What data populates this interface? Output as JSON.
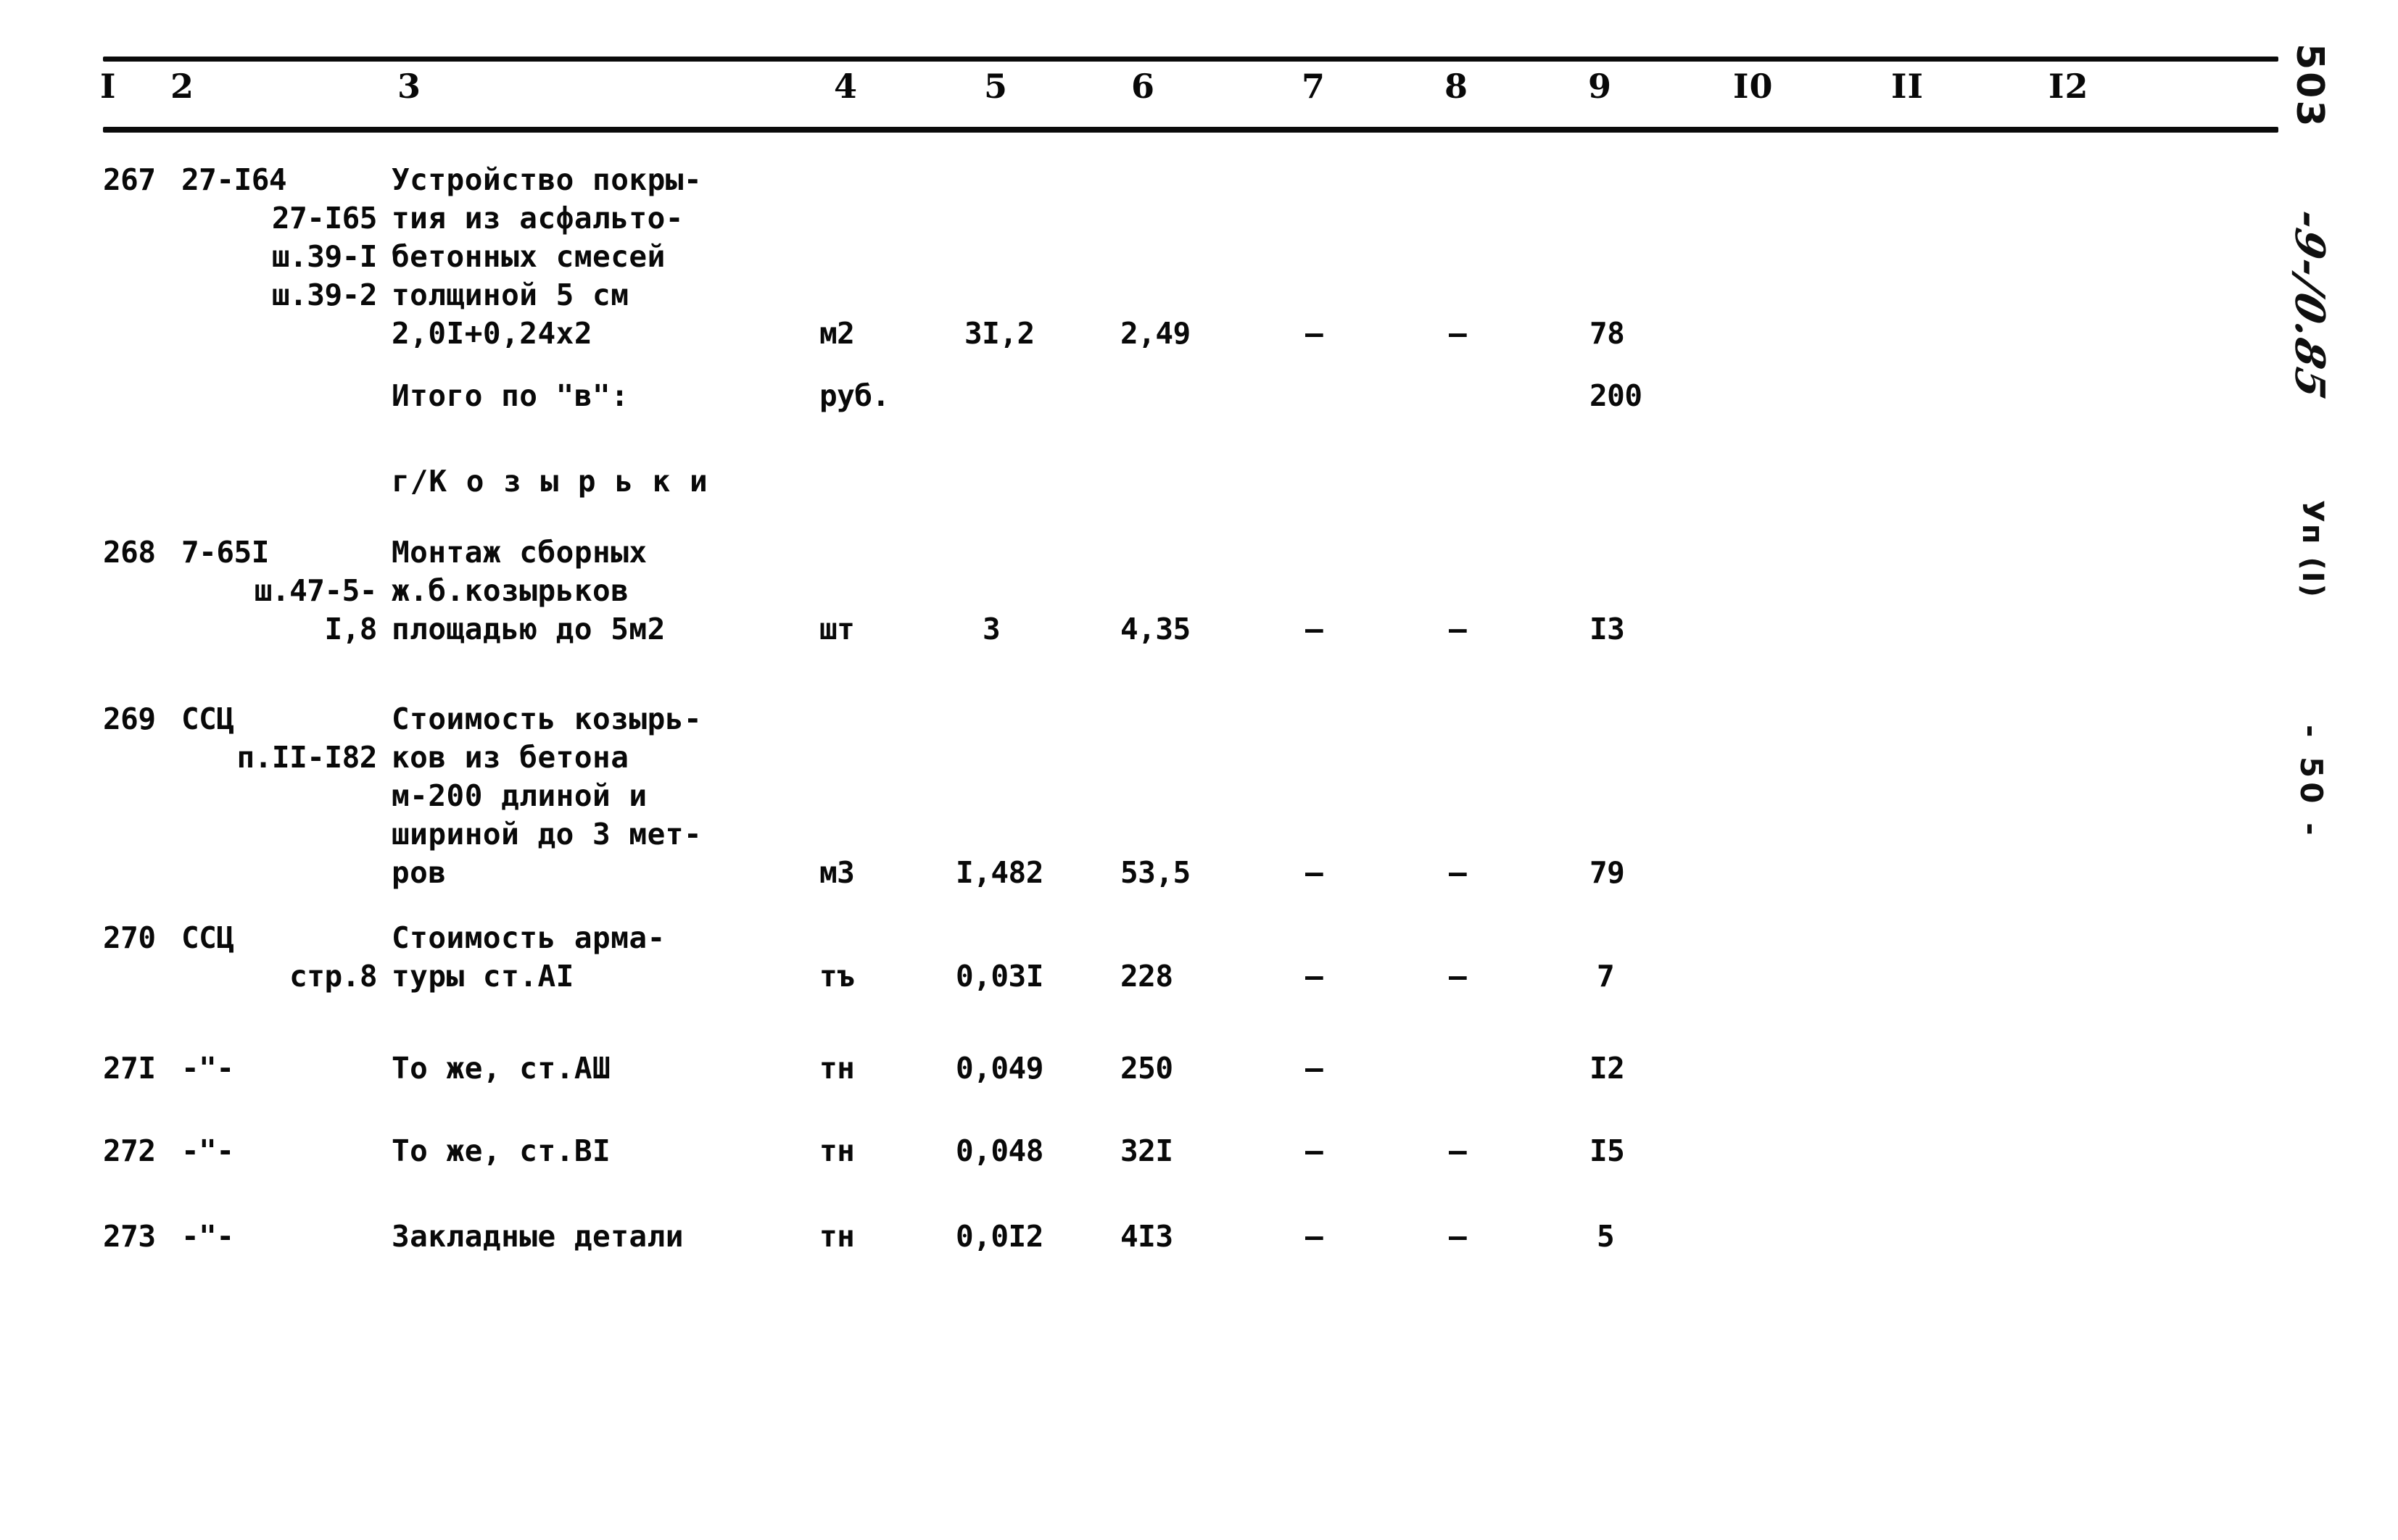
{
  "document": {
    "type": "construction-cost-estimate-table",
    "margin_document_number": "503",
    "margin_handwritten_note": "-9-/0.85",
    "margin_sheet_label": "Уп (I)",
    "margin_page_number": "- 50 -"
  },
  "table": {
    "column_headers": [
      "I",
      "2",
      "3",
      "4",
      "5",
      "6",
      "7",
      "8",
      "9",
      "I0",
      "II",
      "I2"
    ],
    "column_x": [
      68,
      112,
      258,
      540,
      638,
      733,
      845,
      935,
      1030,
      1130,
      1232,
      1340
    ],
    "rows": [
      {
        "kind": "item",
        "no": "267",
        "code_lines": [
          "27-I64",
          "27-I65",
          "ш.39-I",
          "ш.39-2"
        ],
        "desc_lines": [
          "Устройство покры-",
          "тия из асфальто-",
          "бетонных смесей",
          "толщиной 5 см",
          "2,0I+0,24x2"
        ],
        "unit": "м2",
        "qty": "3I,2",
        "price": "2,49",
        "col7": "–",
        "col8": "–",
        "total": "78",
        "col10": "",
        "col11": "",
        "col12": ""
      },
      {
        "kind": "subtotal",
        "no": "",
        "code_lines": [],
        "desc_lines": [
          "Итого по \"в\":"
        ],
        "unit": "руб.",
        "qty": "",
        "price": "",
        "col7": "",
        "col8": "",
        "total": "200",
        "col10": "",
        "col11": "",
        "col12": ""
      },
      {
        "kind": "section",
        "no": "",
        "code_lines": [],
        "desc_lines": [
          "г/К о з ы р ь к и"
        ],
        "unit": "",
        "qty": "",
        "price": "",
        "col7": "",
        "col8": "",
        "total": "",
        "col10": "",
        "col11": "",
        "col12": ""
      },
      {
        "kind": "item",
        "no": "268",
        "code_lines": [
          "7-65I",
          "ш.47-5-",
          "I,8"
        ],
        "desc_lines": [
          "Монтаж сборных",
          "ж.б.козырьков",
          "площадью до 5м2"
        ],
        "unit": "шт",
        "qty": "3",
        "price": "4,35",
        "col7": "–",
        "col8": "–",
        "total": "I3",
        "col10": "",
        "col11": "",
        "col12": ""
      },
      {
        "kind": "item",
        "no": "269",
        "code_lines": [
          "ССЦ",
          "п.II-I82"
        ],
        "desc_lines": [
          "Стоимость козырь-",
          "ков из бетона",
          "м-200 длиной и",
          "шириной до 3 мет-",
          "ров"
        ],
        "unit": "м3",
        "qty": "I,482",
        "price": "53,5",
        "col7": "–",
        "col8": "–",
        "total": "79",
        "col10": "",
        "col11": "",
        "col12": ""
      },
      {
        "kind": "item",
        "no": "270",
        "code_lines": [
          "ССЦ",
          "стр.8"
        ],
        "desc_lines": [
          "Стоимость арма-",
          "туры ст.АI"
        ],
        "unit": "тъ",
        "qty": "0,03I",
        "price": "228",
        "col7": "–",
        "col8": "–",
        "total": "7",
        "col10": "",
        "col11": "",
        "col12": ""
      },
      {
        "kind": "item",
        "no": "27I",
        "code_lines": [
          "-\"-"
        ],
        "desc_lines": [
          "То же, ст.АШ"
        ],
        "unit": "тн",
        "qty": "0,049",
        "price": "250",
        "col7": "–",
        "col8": "",
        "total": "I2",
        "col10": "",
        "col11": "",
        "col12": ""
      },
      {
        "kind": "item",
        "no": "272",
        "code_lines": [
          "-\"-"
        ],
        "desc_lines": [
          "То же, ст.ВI"
        ],
        "unit": "тн",
        "qty": "0,048",
        "price": "32I",
        "col7": "–",
        "col8": "–",
        "total": "I5",
        "col10": "",
        "col11": "",
        "col12": ""
      },
      {
        "kind": "item",
        "no": "273",
        "code_lines": [
          "-\"-"
        ],
        "desc_lines": [
          "Закладные детали"
        ],
        "unit": "тн",
        "qty": "0,0I2",
        "price": "4I3",
        "col7": "–",
        "col8": "–",
        "total": "5",
        "col10": "",
        "col11": "",
        "col12": ""
      }
    ]
  }
}
